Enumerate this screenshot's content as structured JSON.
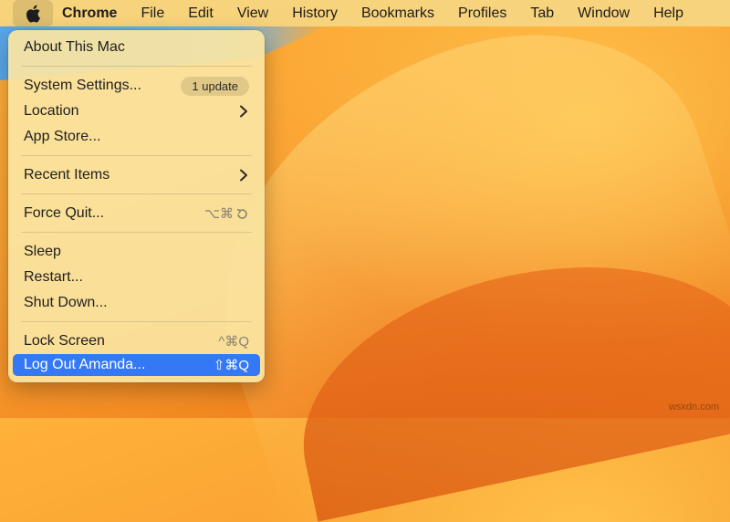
{
  "menubar": {
    "app_name": "Chrome",
    "items": [
      "File",
      "Edit",
      "View",
      "History",
      "Bookmarks",
      "Profiles",
      "Tab",
      "Window",
      "Help"
    ]
  },
  "apple_menu": {
    "about": "About This Mac",
    "system_settings": "System Settings...",
    "update_badge": "1 update",
    "location": "Location",
    "app_store": "App Store...",
    "recent_items": "Recent Items",
    "force_quit": "Force Quit...",
    "force_quit_shortcut": "⌥⌘",
    "sleep": "Sleep",
    "restart": "Restart...",
    "shut_down": "Shut Down...",
    "lock_screen": "Lock Screen",
    "lock_screen_shortcut": "^⌘Q",
    "log_out": "Log Out Amanda...",
    "log_out_shortcut": "⇧⌘Q"
  },
  "watermark": "wsxdn.com",
  "colors": {
    "highlight": "#3478f6",
    "menubar": "#f6d682",
    "menu_bg": "#fae4a0"
  }
}
